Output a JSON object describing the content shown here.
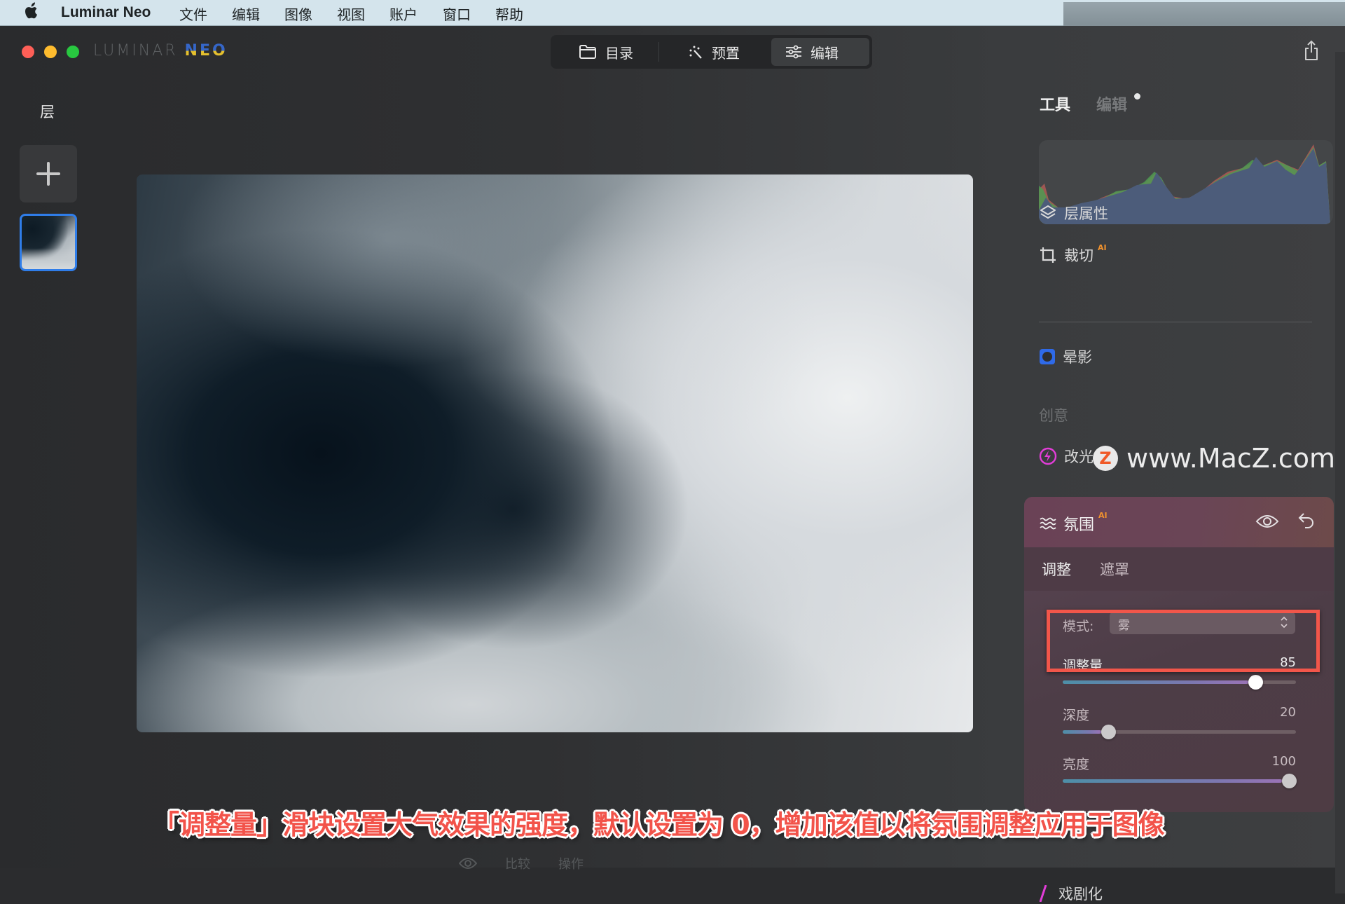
{
  "menubar": {
    "app_name": "Luminar Neo",
    "items": [
      "文件",
      "编辑",
      "图像",
      "视图",
      "账户",
      "窗口",
      "帮助"
    ]
  },
  "window": {
    "logo_left": "LUMINAR",
    "logo_right": "NEO",
    "traffic_colors": {
      "close": "#fe5f57",
      "minimize": "#febc2e",
      "zoom": "#28c840"
    }
  },
  "toolbar": {
    "catalog_label": "目录",
    "catalog_icon": "folder-icon",
    "presets_label": "预置",
    "presets_icon": "magic-wand-icon",
    "edit_label": "编辑",
    "edit_icon": "sliders-icon",
    "active": "编辑",
    "share_icon": "share-icon"
  },
  "layers": {
    "title": "层",
    "add_icon": "plus-icon"
  },
  "right_panel": {
    "tabs": [
      {
        "label": "工具",
        "active": true
      },
      {
        "label": "编辑",
        "active": false,
        "has_dot": true
      }
    ],
    "tools": [
      {
        "label": "层属性",
        "icon": "layers-icon",
        "ai": false
      },
      {
        "label": "裁切",
        "icon": "crop-icon",
        "ai": true
      },
      {
        "label": "晕影",
        "icon": "vignette-icon",
        "ai": false
      }
    ],
    "section_creative": "创意",
    "relight": {
      "label": "改光",
      "icon": "lightning-icon",
      "ai": true
    },
    "watermark": {
      "logo": "Z",
      "text": "www.MacZ.com"
    },
    "ai_badge": "AI",
    "drama": {
      "label": "戏剧化",
      "icon": "drama-icon"
    }
  },
  "atmosphere": {
    "title": "氛围",
    "ai_badge": "AI",
    "icon": "waves-icon",
    "tabs": [
      {
        "label": "调整",
        "active": true
      },
      {
        "label": "遮罩",
        "active": false
      }
    ],
    "mode_label": "模式:",
    "mode_value": "雾",
    "sliders": [
      {
        "label": "调整量",
        "value": "85",
        "fraction": 0.85,
        "highlighted": true
      },
      {
        "label": "深度",
        "value": "20",
        "fraction": 0.2,
        "highlighted": false
      },
      {
        "label": "亮度",
        "value": "100",
        "fraction": 1.0,
        "highlighted": false
      }
    ],
    "highlight_color": "#f2564a"
  },
  "bottom_bar": {
    "items": [
      "比较",
      "操作"
    ]
  },
  "caption": "「调整量」滑块设置大气效果的强度，默认设置为 0，增加该值以将氛围调整应用于图像",
  "colors": {
    "accent_blue": "#2f7de9",
    "ai_orange": "#f0922e",
    "caption_red": "#f2534a",
    "relight_pink": "#e23dd8"
  }
}
